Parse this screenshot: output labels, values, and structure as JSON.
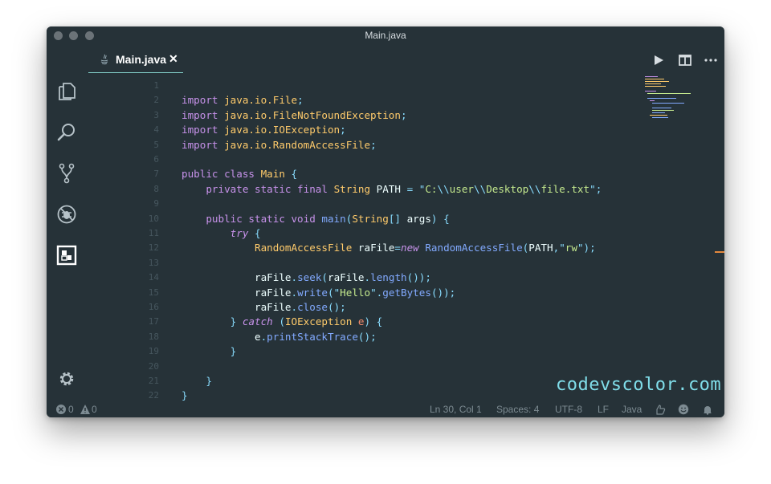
{
  "window": {
    "title": "Main.java"
  },
  "tab": {
    "label": "Main.java",
    "close": "✕"
  },
  "activity_icons": [
    "files-icon",
    "search-icon",
    "source-control-icon",
    "debug-icon",
    "extensions-icon",
    "settings-gear-icon"
  ],
  "editor": {
    "lines": [
      {
        "n": "1",
        "tokens": []
      },
      {
        "n": "2",
        "tokens": [
          {
            "t": "import ",
            "c": "kw"
          },
          {
            "t": "java.io.File",
            "c": "ty"
          },
          {
            "t": ";",
            "c": "op"
          }
        ]
      },
      {
        "n": "3",
        "tokens": [
          {
            "t": "import ",
            "c": "kw"
          },
          {
            "t": "java.io.FileNotFoundException",
            "c": "ty"
          },
          {
            "t": ";",
            "c": "op"
          }
        ]
      },
      {
        "n": "4",
        "tokens": [
          {
            "t": "import ",
            "c": "kw"
          },
          {
            "t": "java.io.IOException",
            "c": "ty"
          },
          {
            "t": ";",
            "c": "op"
          }
        ]
      },
      {
        "n": "5",
        "tokens": [
          {
            "t": "import ",
            "c": "kw"
          },
          {
            "t": "java.io.RandomAccessFile",
            "c": "ty"
          },
          {
            "t": ";",
            "c": "op"
          }
        ]
      },
      {
        "n": "6",
        "tokens": []
      },
      {
        "n": "7",
        "tokens": [
          {
            "t": "public class ",
            "c": "kw"
          },
          {
            "t": "Main",
            "c": "ty"
          },
          {
            "t": " {",
            "c": "op"
          }
        ]
      },
      {
        "n": "8",
        "tokens": [
          {
            "t": "    private static final ",
            "c": "kw"
          },
          {
            "t": "String",
            "c": "ty"
          },
          {
            "t": " PATH ",
            "c": "pl"
          },
          {
            "t": "=",
            "c": "op"
          },
          {
            "t": " \"",
            "c": "op"
          },
          {
            "t": "C:",
            "c": "st"
          },
          {
            "t": "\\\\",
            "c": "op"
          },
          {
            "t": "user",
            "c": "st"
          },
          {
            "t": "\\\\",
            "c": "op"
          },
          {
            "t": "Desktop",
            "c": "st"
          },
          {
            "t": "\\\\",
            "c": "op"
          },
          {
            "t": "file.txt",
            "c": "st"
          },
          {
            "t": "\";",
            "c": "op"
          }
        ]
      },
      {
        "n": "9",
        "tokens": []
      },
      {
        "n": "10",
        "tokens": [
          {
            "t": "    public static void ",
            "c": "kw"
          },
          {
            "t": "main",
            "c": "fn"
          },
          {
            "t": "(",
            "c": "op"
          },
          {
            "t": "String",
            "c": "ty"
          },
          {
            "t": "[] ",
            "c": "op"
          },
          {
            "t": "args",
            "c": "pl"
          },
          {
            "t": ") {",
            "c": "op"
          }
        ]
      },
      {
        "n": "11",
        "tokens": [
          {
            "t": "        ",
            "c": "pl"
          },
          {
            "t": "try",
            "c": "it"
          },
          {
            "t": " {",
            "c": "op"
          }
        ]
      },
      {
        "n": "12",
        "tokens": [
          {
            "t": "            ",
            "c": "pl"
          },
          {
            "t": "RandomAccessFile",
            "c": "ty"
          },
          {
            "t": " raFile",
            "c": "pl"
          },
          {
            "t": "=",
            "c": "op"
          },
          {
            "t": "new",
            "c": "it"
          },
          {
            "t": " ",
            "c": "pl"
          },
          {
            "t": "RandomAccessFile",
            "c": "fn"
          },
          {
            "t": "(",
            "c": "op"
          },
          {
            "t": "PATH",
            "c": "pl"
          },
          {
            "t": ",\"",
            "c": "op"
          },
          {
            "t": "rw",
            "c": "st"
          },
          {
            "t": "\");",
            "c": "op"
          }
        ]
      },
      {
        "n": "13",
        "tokens": []
      },
      {
        "n": "14",
        "tokens": [
          {
            "t": "            raFile",
            "c": "pl"
          },
          {
            "t": ".",
            "c": "op"
          },
          {
            "t": "seek",
            "c": "fn"
          },
          {
            "t": "(",
            "c": "op"
          },
          {
            "t": "raFile",
            "c": "pl"
          },
          {
            "t": ".",
            "c": "op"
          },
          {
            "t": "length",
            "c": "fn"
          },
          {
            "t": "());",
            "c": "op"
          }
        ]
      },
      {
        "n": "15",
        "tokens": [
          {
            "t": "            raFile",
            "c": "pl"
          },
          {
            "t": ".",
            "c": "op"
          },
          {
            "t": "write",
            "c": "fn"
          },
          {
            "t": "(\"",
            "c": "op"
          },
          {
            "t": "Hello",
            "c": "st"
          },
          {
            "t": "\".",
            "c": "op"
          },
          {
            "t": "getBytes",
            "c": "fn"
          },
          {
            "t": "());",
            "c": "op"
          }
        ]
      },
      {
        "n": "16",
        "tokens": [
          {
            "t": "            raFile",
            "c": "pl"
          },
          {
            "t": ".",
            "c": "op"
          },
          {
            "t": "close",
            "c": "fn"
          },
          {
            "t": "();",
            "c": "op"
          }
        ]
      },
      {
        "n": "17",
        "tokens": [
          {
            "t": "        } ",
            "c": "op"
          },
          {
            "t": "catch",
            "c": "it"
          },
          {
            "t": " (",
            "c": "op"
          },
          {
            "t": "IOException",
            "c": "ty"
          },
          {
            "t": " e",
            "c": "pr"
          },
          {
            "t": ") {",
            "c": "op"
          }
        ]
      },
      {
        "n": "18",
        "tokens": [
          {
            "t": "            e",
            "c": "pl"
          },
          {
            "t": ".",
            "c": "op"
          },
          {
            "t": "printStackTrace",
            "c": "fn"
          },
          {
            "t": "();",
            "c": "op"
          }
        ]
      },
      {
        "n": "19",
        "tokens": [
          {
            "t": "        }",
            "c": "op"
          }
        ]
      },
      {
        "n": "20",
        "tokens": []
      },
      {
        "n": "21",
        "tokens": [
          {
            "t": "    }",
            "c": "op"
          }
        ]
      },
      {
        "n": "22",
        "tokens": [
          {
            "t": "}",
            "c": "op"
          }
        ]
      }
    ]
  },
  "watermark": "codevscolor.com",
  "statusbar": {
    "errors": "0",
    "warnings": "0",
    "position": "Ln 30, Col 1",
    "spaces": "Spaces: 4",
    "encoding": "UTF-8",
    "eol": "LF",
    "language": "Java"
  },
  "colors": {
    "background": "#263238",
    "keyword": "#c792ea",
    "type": "#ffcb6b",
    "string": "#c3e88d",
    "function": "#82aaff",
    "punctuation": "#89ddff",
    "accent": "#80cbc4"
  }
}
